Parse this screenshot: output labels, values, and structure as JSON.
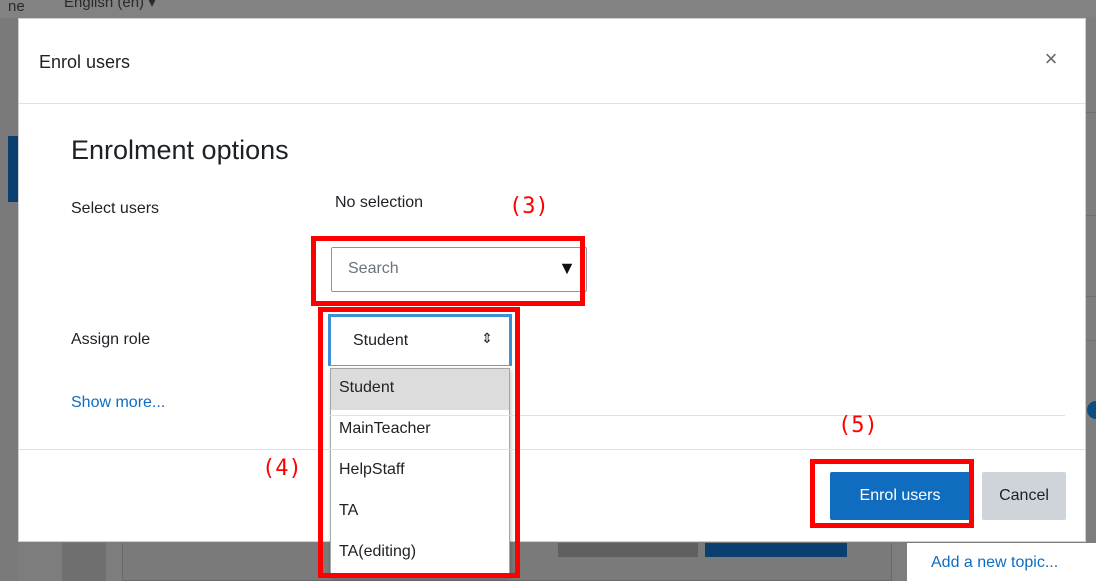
{
  "background": {
    "top_bar_text": "ne",
    "language_menu": "English (en) ▾",
    "sidebar_link": "Add a new topic..."
  },
  "modal": {
    "title": "Enrol users",
    "close_icon": "×",
    "section_title": "Enrolment options",
    "select_users_label": "Select users",
    "selection_status": "No selection",
    "search": {
      "placeholder": "Search",
      "arrow": "▼"
    },
    "assign_role_label": "Assign role",
    "role_select": {
      "value": "Student",
      "caret": "⇕"
    },
    "role_options": [
      "Student",
      "MainTeacher",
      "HelpStaff",
      "TA",
      "TA(editing)"
    ],
    "show_more": "Show more...",
    "buttons": {
      "enrol": "Enrol users",
      "cancel": "Cancel"
    }
  },
  "annotations": {
    "step3": "(3)",
    "step4": "(4)",
    "step5": "(5)",
    "color": "#ff0000"
  },
  "colors": {
    "primary": "#0f6cbf",
    "secondary": "#ced4da",
    "focus": "#3d8fd6"
  }
}
